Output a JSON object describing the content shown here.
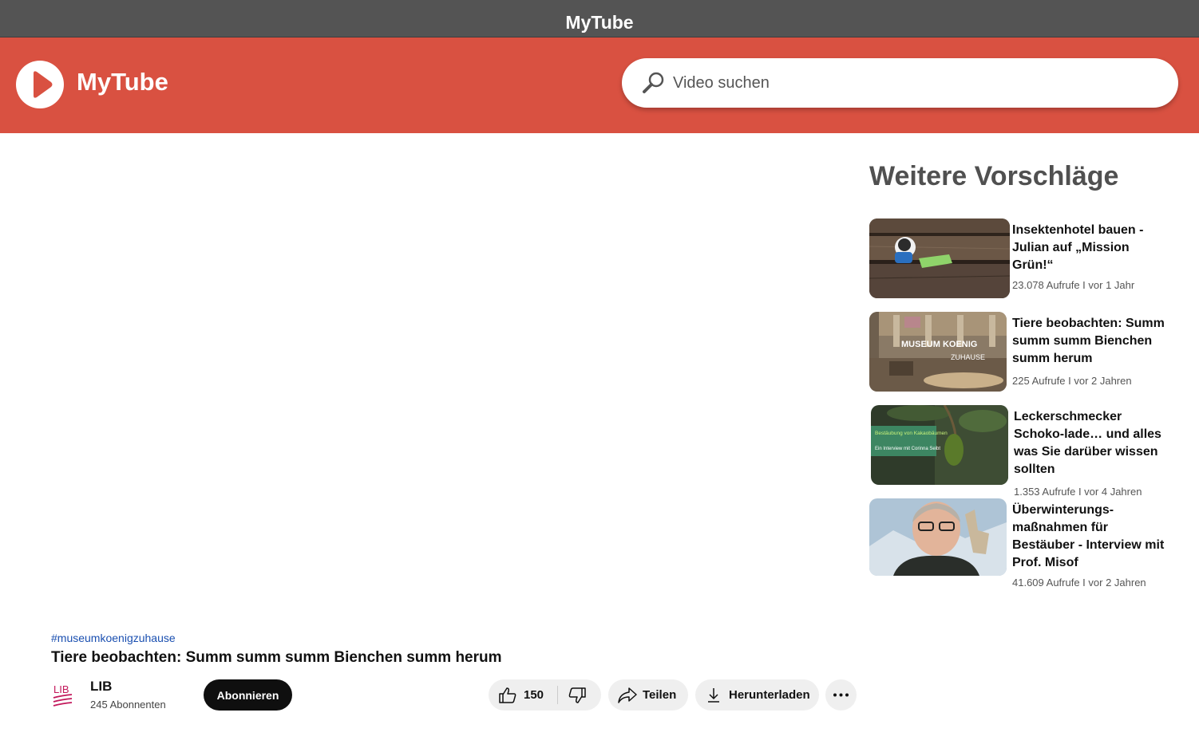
{
  "window": {
    "title": "MyTube"
  },
  "header": {
    "logo_text": "MyTube",
    "search": {
      "placeholder": "Video suchen",
      "value": ""
    }
  },
  "sidebar": {
    "title": "Weitere Vorschläge",
    "items": [
      {
        "title": "Insektenhotel bauen - Julian auf „Mission Grün!“",
        "meta": "23.078 Aufrufe I vor 1 Jahr"
      },
      {
        "title": "Tiere beobachten: Summ summ summ Bienchen summ herum",
        "meta": "225 Aufrufe I vor 2 Jahren",
        "thumb_text_1": "MUSEUM KOENIG",
        "thumb_text_2": "ZUHAUSE"
      },
      {
        "title": "Leckerschmecker Schoko-lade… und alles was Sie darüber wissen sollten",
        "meta": "1.353  Aufrufe I vor 4 Jahren",
        "thumb_text_1": "Bestäubung von Kakaobäumen",
        "thumb_text_2": "Ein Interview mit Corinna Seibt"
      },
      {
        "title": "Überwinterungs-maßnahmen für Bestäuber - Interview mit Prof. Misof",
        "meta": "41.609 Aufrufe I vor 2 Jahren"
      }
    ]
  },
  "video": {
    "hashtag": "#museumkoenigzuhause",
    "title": "Tiere beobachten: Summ summ summ Bienchen summ herum",
    "channel": {
      "name": "LIB",
      "subscribers": "245 Abonnenten",
      "avatar_text": "LIB"
    },
    "subscribe_label": "Abonnieren",
    "likes": "150",
    "share_label": "Teilen",
    "download_label": "Herunterladen"
  },
  "colors": {
    "header": "#d95141",
    "titlebar": "#545454",
    "subscribe": "#0f0f0f",
    "pill": "#efefef",
    "hashtag": "#1a4fb0"
  },
  "icons": [
    "play-logo-icon",
    "search-icon",
    "thumbs-up-icon",
    "thumbs-down-icon",
    "share-icon",
    "download-icon",
    "more-icon"
  ]
}
